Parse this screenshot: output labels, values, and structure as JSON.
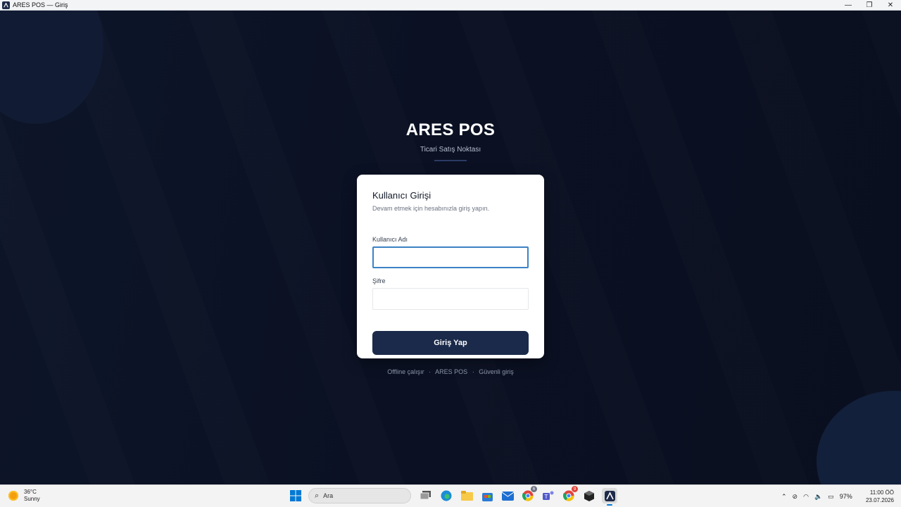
{
  "window": {
    "title": "ARES POS — Giriş",
    "controls": {
      "minimize": "—",
      "maximize": "❐",
      "close": "✕"
    }
  },
  "brand": {
    "title": "ARES POS",
    "subtitle": "Ticari Satış Noktası"
  },
  "login": {
    "title": "Kullanıcı Girişi",
    "subtitle": "Devam etmek için hesabınızla giriş yapın.",
    "username_label": "Kullanıcı Adı",
    "username_value": "",
    "password_label": "Şifre",
    "password_value": "",
    "submit_label": "Giriş Yap"
  },
  "footer": {
    "offline": "Offline çalışır",
    "brand": "ARES POS",
    "secure": "Güvenli giriş",
    "separator": "·"
  },
  "taskbar": {
    "weather_temp": "36°C",
    "weather_desc": "Sunny",
    "search_placeholder": "Ara",
    "apps": [
      {
        "icon": "windows-start-icon"
      },
      {
        "icon": "task-view-icon"
      },
      {
        "icon": "edge-browser-icon"
      },
      {
        "icon": "file-explorer-icon"
      },
      {
        "icon": "microsoft-store-icon"
      },
      {
        "icon": "mail-icon"
      },
      {
        "icon": "chrome-icon",
        "badge": "6"
      },
      {
        "icon": "teams-icon"
      },
      {
        "icon": "chrome-icon",
        "badge": "9"
      },
      {
        "icon": "app-box-icon"
      },
      {
        "icon": "ares-pos-icon",
        "active": true
      }
    ],
    "battery": "97%",
    "time": "11:00 ÖÖ",
    "date": "23.07.2026"
  },
  "colors": {
    "background": "#0b1020",
    "card": "#ffffff",
    "primary_button": "#1b2a4a",
    "focus_border": "#3b82c4"
  }
}
